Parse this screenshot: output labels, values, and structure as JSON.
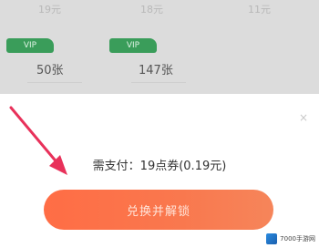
{
  "top_row": {
    "left": "19元",
    "middle": "18元",
    "right": "11元"
  },
  "packs": [
    {
      "tag": "VIP",
      "count": "50张"
    },
    {
      "tag": "VIP",
      "count": "147张"
    }
  ],
  "sheet": {
    "close_icon": "×",
    "pay_text": "需支付：19点券(0.19元)",
    "cta_label": "兑换并解锁"
  },
  "watermark": {
    "text": "7000手游网"
  },
  "colors": {
    "accent": "#f9784e",
    "tag_green": "#3a9d5a",
    "arrow": "#e8315a"
  }
}
